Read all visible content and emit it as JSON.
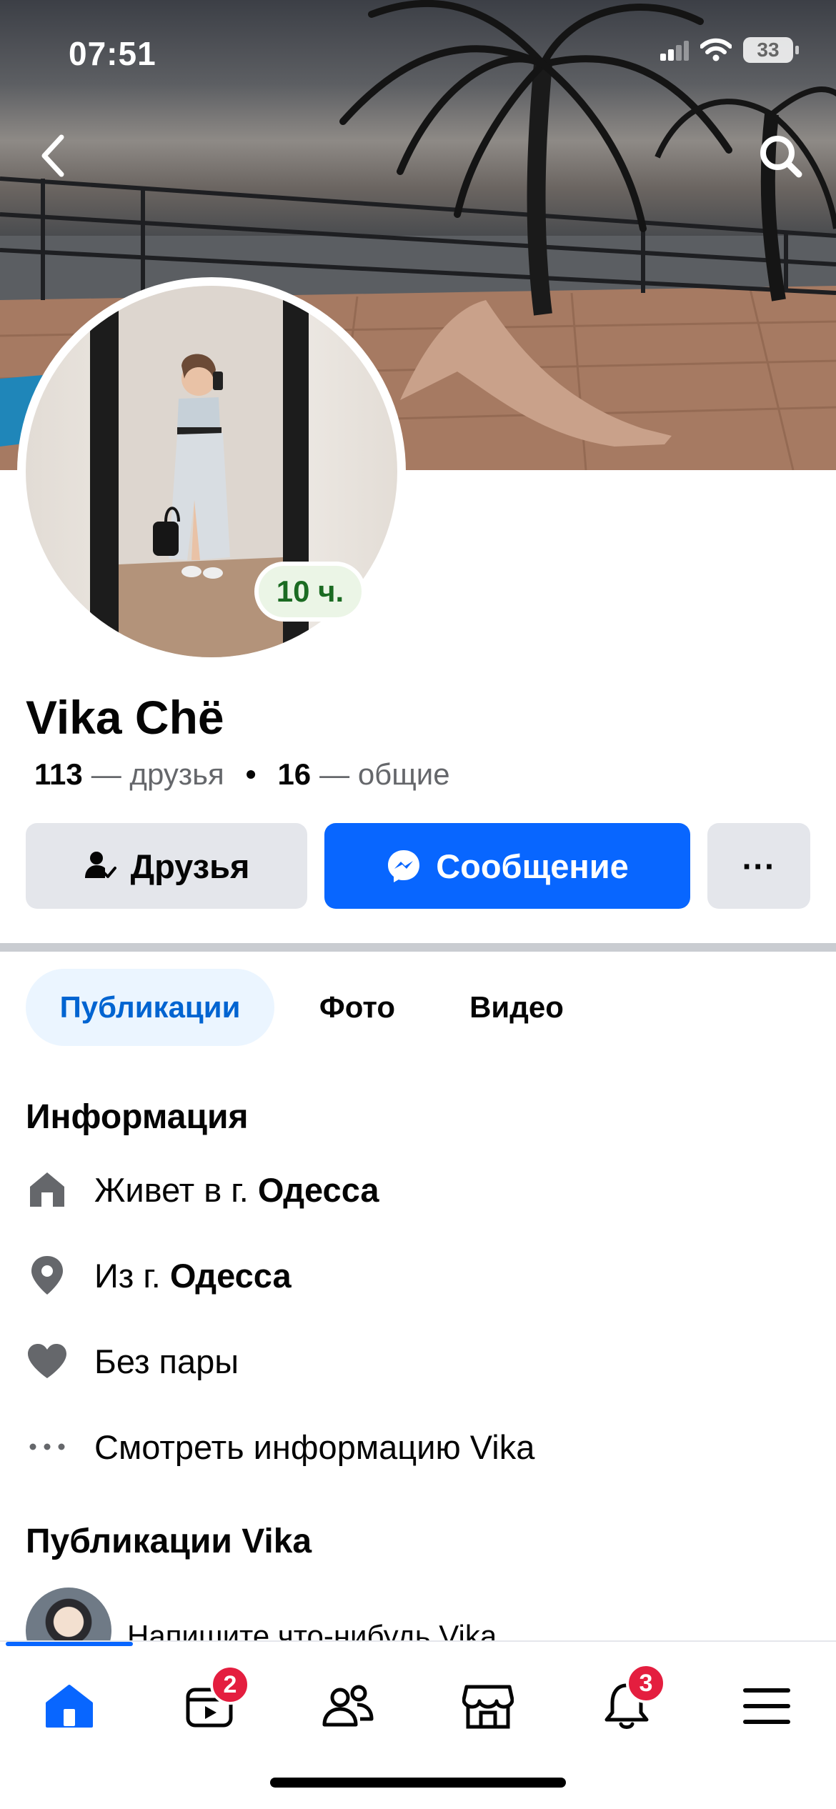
{
  "status_bar": {
    "time": "07:51",
    "battery": "33"
  },
  "header": {
    "back_icon": "chevron-left-icon",
    "search_icon": "search-icon"
  },
  "profile": {
    "name": "Vika Chё",
    "story_badge": "10 ч.",
    "friends_count": "113",
    "friends_label": "— друзья",
    "separator": "•",
    "mutual_count": "16",
    "mutual_label": "— общие"
  },
  "actions": {
    "friends_label": "Друзья",
    "message_label": "Сообщение",
    "more_label": "···"
  },
  "tabs": [
    {
      "label": "Публикации",
      "active": true
    },
    {
      "label": "Фото",
      "active": false
    },
    {
      "label": "Видео",
      "active": false
    }
  ],
  "info": {
    "title": "Информация",
    "lives_prefix": "Живет в г. ",
    "lives_city": "Одесса",
    "from_prefix": "Из г. ",
    "from_city": "Одесса",
    "relationship": "Без пары",
    "see_more": "Смотреть информацию Vika"
  },
  "posts": {
    "title": "Публикации Vika",
    "composer_placeholder": "Напишите что-нибудь Vika..."
  },
  "bottom_nav": {
    "items": [
      {
        "icon": "home-icon",
        "badge": ""
      },
      {
        "icon": "video-icon",
        "badge": "2"
      },
      {
        "icon": "friends-icon",
        "badge": ""
      },
      {
        "icon": "marketplace-icon",
        "badge": ""
      },
      {
        "icon": "bell-icon",
        "badge": "3"
      },
      {
        "icon": "menu-icon",
        "badge": ""
      }
    ]
  },
  "colors": {
    "accent": "#0866ff",
    "badge": "#e41e3f",
    "story_green": "#1b6b22"
  }
}
